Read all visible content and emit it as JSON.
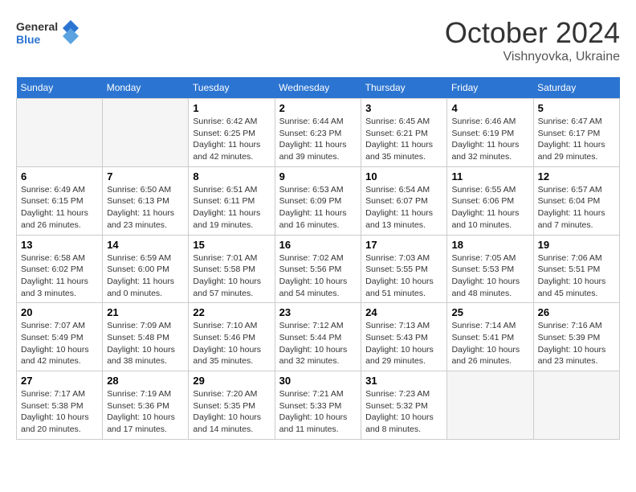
{
  "header": {
    "logo_line1": "General",
    "logo_line2": "Blue",
    "month": "October 2024",
    "location": "Vishnyovka, Ukraine"
  },
  "weekdays": [
    "Sunday",
    "Monday",
    "Tuesday",
    "Wednesday",
    "Thursday",
    "Friday",
    "Saturday"
  ],
  "weeks": [
    [
      {
        "day": "",
        "empty": true
      },
      {
        "day": "",
        "empty": true
      },
      {
        "day": "1",
        "sunrise": "Sunrise: 6:42 AM",
        "sunset": "Sunset: 6:25 PM",
        "daylight": "Daylight: 11 hours and 42 minutes."
      },
      {
        "day": "2",
        "sunrise": "Sunrise: 6:44 AM",
        "sunset": "Sunset: 6:23 PM",
        "daylight": "Daylight: 11 hours and 39 minutes."
      },
      {
        "day": "3",
        "sunrise": "Sunrise: 6:45 AM",
        "sunset": "Sunset: 6:21 PM",
        "daylight": "Daylight: 11 hours and 35 minutes."
      },
      {
        "day": "4",
        "sunrise": "Sunrise: 6:46 AM",
        "sunset": "Sunset: 6:19 PM",
        "daylight": "Daylight: 11 hours and 32 minutes."
      },
      {
        "day": "5",
        "sunrise": "Sunrise: 6:47 AM",
        "sunset": "Sunset: 6:17 PM",
        "daylight": "Daylight: 11 hours and 29 minutes."
      }
    ],
    [
      {
        "day": "6",
        "sunrise": "Sunrise: 6:49 AM",
        "sunset": "Sunset: 6:15 PM",
        "daylight": "Daylight: 11 hours and 26 minutes."
      },
      {
        "day": "7",
        "sunrise": "Sunrise: 6:50 AM",
        "sunset": "Sunset: 6:13 PM",
        "daylight": "Daylight: 11 hours and 23 minutes."
      },
      {
        "day": "8",
        "sunrise": "Sunrise: 6:51 AM",
        "sunset": "Sunset: 6:11 PM",
        "daylight": "Daylight: 11 hours and 19 minutes."
      },
      {
        "day": "9",
        "sunrise": "Sunrise: 6:53 AM",
        "sunset": "Sunset: 6:09 PM",
        "daylight": "Daylight: 11 hours and 16 minutes."
      },
      {
        "day": "10",
        "sunrise": "Sunrise: 6:54 AM",
        "sunset": "Sunset: 6:07 PM",
        "daylight": "Daylight: 11 hours and 13 minutes."
      },
      {
        "day": "11",
        "sunrise": "Sunrise: 6:55 AM",
        "sunset": "Sunset: 6:06 PM",
        "daylight": "Daylight: 11 hours and 10 minutes."
      },
      {
        "day": "12",
        "sunrise": "Sunrise: 6:57 AM",
        "sunset": "Sunset: 6:04 PM",
        "daylight": "Daylight: 11 hours and 7 minutes."
      }
    ],
    [
      {
        "day": "13",
        "sunrise": "Sunrise: 6:58 AM",
        "sunset": "Sunset: 6:02 PM",
        "daylight": "Daylight: 11 hours and 3 minutes."
      },
      {
        "day": "14",
        "sunrise": "Sunrise: 6:59 AM",
        "sunset": "Sunset: 6:00 PM",
        "daylight": "Daylight: 11 hours and 0 minutes."
      },
      {
        "day": "15",
        "sunrise": "Sunrise: 7:01 AM",
        "sunset": "Sunset: 5:58 PM",
        "daylight": "Daylight: 10 hours and 57 minutes."
      },
      {
        "day": "16",
        "sunrise": "Sunrise: 7:02 AM",
        "sunset": "Sunset: 5:56 PM",
        "daylight": "Daylight: 10 hours and 54 minutes."
      },
      {
        "day": "17",
        "sunrise": "Sunrise: 7:03 AM",
        "sunset": "Sunset: 5:55 PM",
        "daylight": "Daylight: 10 hours and 51 minutes."
      },
      {
        "day": "18",
        "sunrise": "Sunrise: 7:05 AM",
        "sunset": "Sunset: 5:53 PM",
        "daylight": "Daylight: 10 hours and 48 minutes."
      },
      {
        "day": "19",
        "sunrise": "Sunrise: 7:06 AM",
        "sunset": "Sunset: 5:51 PM",
        "daylight": "Daylight: 10 hours and 45 minutes."
      }
    ],
    [
      {
        "day": "20",
        "sunrise": "Sunrise: 7:07 AM",
        "sunset": "Sunset: 5:49 PM",
        "daylight": "Daylight: 10 hours and 42 minutes."
      },
      {
        "day": "21",
        "sunrise": "Sunrise: 7:09 AM",
        "sunset": "Sunset: 5:48 PM",
        "daylight": "Daylight: 10 hours and 38 minutes."
      },
      {
        "day": "22",
        "sunrise": "Sunrise: 7:10 AM",
        "sunset": "Sunset: 5:46 PM",
        "daylight": "Daylight: 10 hours and 35 minutes."
      },
      {
        "day": "23",
        "sunrise": "Sunrise: 7:12 AM",
        "sunset": "Sunset: 5:44 PM",
        "daylight": "Daylight: 10 hours and 32 minutes."
      },
      {
        "day": "24",
        "sunrise": "Sunrise: 7:13 AM",
        "sunset": "Sunset: 5:43 PM",
        "daylight": "Daylight: 10 hours and 29 minutes."
      },
      {
        "day": "25",
        "sunrise": "Sunrise: 7:14 AM",
        "sunset": "Sunset: 5:41 PM",
        "daylight": "Daylight: 10 hours and 26 minutes."
      },
      {
        "day": "26",
        "sunrise": "Sunrise: 7:16 AM",
        "sunset": "Sunset: 5:39 PM",
        "daylight": "Daylight: 10 hours and 23 minutes."
      }
    ],
    [
      {
        "day": "27",
        "sunrise": "Sunrise: 7:17 AM",
        "sunset": "Sunset: 5:38 PM",
        "daylight": "Daylight: 10 hours and 20 minutes."
      },
      {
        "day": "28",
        "sunrise": "Sunrise: 7:19 AM",
        "sunset": "Sunset: 5:36 PM",
        "daylight": "Daylight: 10 hours and 17 minutes."
      },
      {
        "day": "29",
        "sunrise": "Sunrise: 7:20 AM",
        "sunset": "Sunset: 5:35 PM",
        "daylight": "Daylight: 10 hours and 14 minutes."
      },
      {
        "day": "30",
        "sunrise": "Sunrise: 7:21 AM",
        "sunset": "Sunset: 5:33 PM",
        "daylight": "Daylight: 10 hours and 11 minutes."
      },
      {
        "day": "31",
        "sunrise": "Sunrise: 7:23 AM",
        "sunset": "Sunset: 5:32 PM",
        "daylight": "Daylight: 10 hours and 8 minutes."
      },
      {
        "day": "",
        "empty": true
      },
      {
        "day": "",
        "empty": true
      }
    ]
  ]
}
